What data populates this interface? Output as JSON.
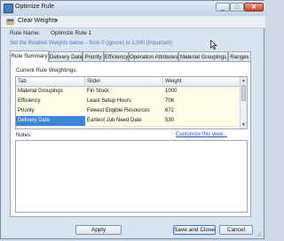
{
  "window": {
    "title": "Optimize Rule",
    "controls": {
      "minimize": "_",
      "maximize": "□",
      "close": "✕"
    }
  },
  "toolbar": {
    "clear_weights": "Clear Weights",
    "dropdown_arrow": "▾"
  },
  "rule": {
    "label": "Rule Name:",
    "value": "Optimize Rule 1"
  },
  "hint": "Set the Relative Weights below – from 0 (ignore) to 1,000 (important)",
  "tabs": [
    "Rule Summary",
    "Delivery Date",
    "Priority",
    "Efficiency",
    "Operation Attributes",
    "Material Groupings",
    "Ranges"
  ],
  "weightings": {
    "title": "Current Rule Weightings:",
    "columns": [
      "Tab",
      "Slider",
      "Weight"
    ],
    "rows": [
      {
        "tab": "Material Groupings",
        "slider": "Fin Stock",
        "weight": "1000"
      },
      {
        "tab": "Efficiency",
        "slider": "Least Setup Hours",
        "weight": "706"
      },
      {
        "tab": "Priority",
        "slider": "Fewest Eligible Resources",
        "weight": "672"
      },
      {
        "tab": "Delivery Date",
        "slider": "Earliest Job Need Date",
        "weight": "530"
      }
    ]
  },
  "notes": {
    "label": "Notes:",
    "customize": "Customize this view..."
  },
  "buttons": {
    "apply": "Apply",
    "save_close": "Save and Close",
    "cancel": "Cancel"
  },
  "scrollbar": {
    "up": "▲",
    "down": "▼"
  },
  "colors": {
    "accent": "#3a86dc",
    "hint": "#4a73b5",
    "link": "#1a4fd6",
    "row_bg": "#fffee8"
  }
}
